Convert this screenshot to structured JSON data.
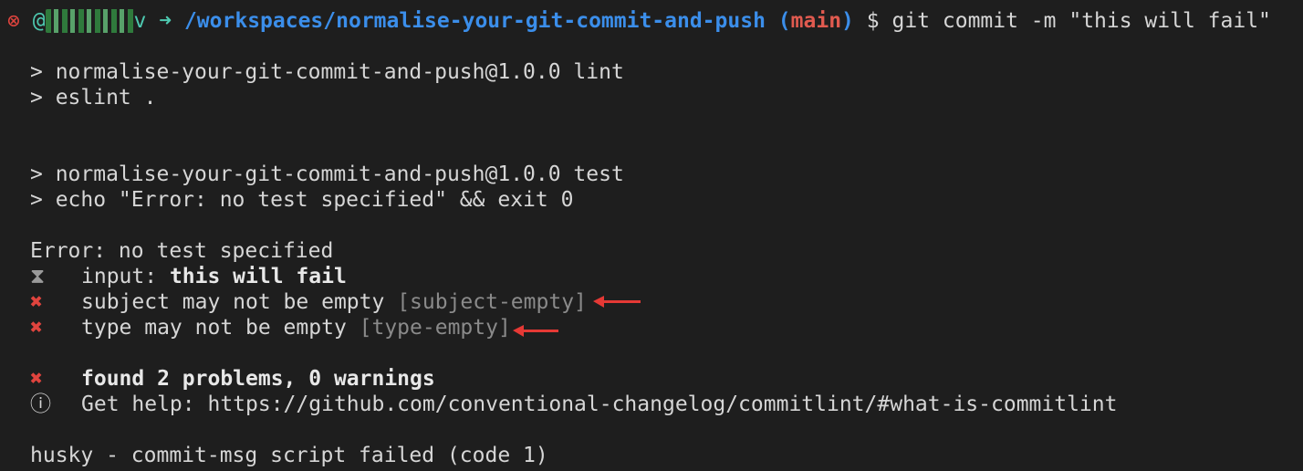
{
  "prompt": {
    "status_icon": "⊗",
    "user_prefix": "@",
    "user_suffix": "v",
    "arrow": "➜",
    "path": "/workspaces/normalise-your-git-commit-and-push",
    "branch_open": "(",
    "branch": "main",
    "branch_close": ")",
    "symbol": "$",
    "command": "git commit -m \"this will fail\""
  },
  "lint": {
    "line1": "> normalise-your-git-commit-and-push@1.0.0 lint",
    "line2": "> eslint ."
  },
  "test": {
    "line1": "> normalise-your-git-commit-and-push@1.0.0 test",
    "line2": "> echo \"Error: no test specified\" && exit 0"
  },
  "error_line": "Error: no test specified",
  "commitlint": {
    "input_icon": "⧗",
    "input_label": "input: ",
    "input_value": "this will fail",
    "problems": [
      {
        "icon": "✖",
        "message": "subject may not be empty ",
        "rule": "[subject-empty]"
      },
      {
        "icon": "✖",
        "message": "type may not be empty ",
        "rule": "[type-empty]"
      }
    ],
    "summary_icon": "✖",
    "summary": "found 2 problems, 0 warnings",
    "help_icon": "ⓘ",
    "help": "Get help: https://github.com/conventional-changelog/commitlint/#what-is-commitlint"
  },
  "husky": "husky - commit-msg script failed (code 1)",
  "colors": {
    "background": "#1e1e1e",
    "error": "#e0443e",
    "path": "#3b8eea",
    "branch": "#e05a4f",
    "annotation_arrow": "#e53935"
  }
}
